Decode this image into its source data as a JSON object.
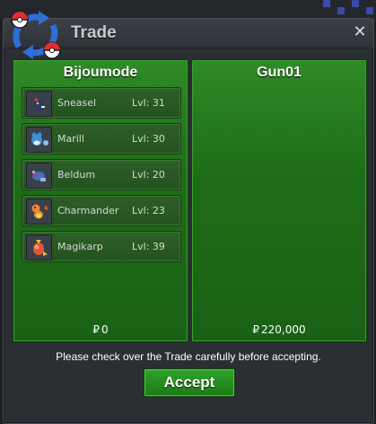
{
  "window": {
    "title": "Trade",
    "close_glyph": "✕",
    "logo_icon": "trade-arrows-pokeball-icon"
  },
  "left_panel": {
    "trainer_name": "Bijoumode",
    "pokemon": [
      {
        "name": "Sneasel",
        "level": "Lvl: 31",
        "icon": "sneasel-sprite-icon"
      },
      {
        "name": "Marill",
        "level": "Lvl: 30",
        "icon": "marill-sprite-icon"
      },
      {
        "name": "Beldum",
        "level": "Lvl: 20",
        "icon": "beldum-sprite-icon"
      },
      {
        "name": "Charmander",
        "level": "Lvl: 23",
        "icon": "charmander-sprite-icon"
      },
      {
        "name": "Magikarp",
        "level": "Lvl: 39",
        "icon": "magikarp-sprite-icon"
      }
    ],
    "money_symbol": "₽",
    "money": "0"
  },
  "right_panel": {
    "trainer_name": "Gun01",
    "pokemon": [],
    "money_symbol": "₽",
    "money": "220,000"
  },
  "notice": "Please check over the Trade carefully before accepting.",
  "accept_label": "Accept",
  "colors": {
    "panel_green": "#1f6d18",
    "accept_green": "#2fa22a",
    "window_bg": "#2b2e33"
  }
}
